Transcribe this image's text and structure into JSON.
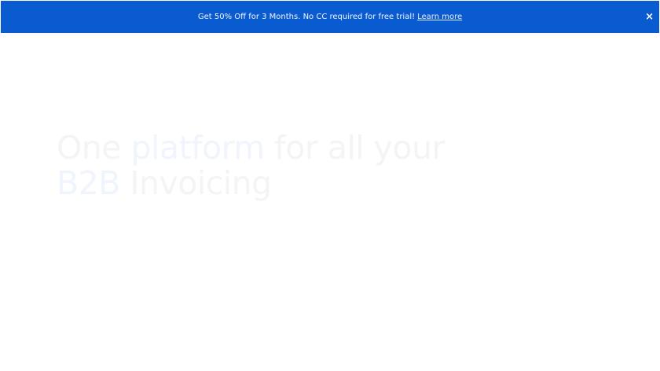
{
  "banner": {
    "text": "Get 50% Off for 3 Months. No CC required for free trial!",
    "link": "Learn more",
    "close": "×",
    "color": "#0b5bd0"
  },
  "hero": {
    "w1": "One",
    "w2": "platform",
    "w3": "for all your",
    "w4": "B2B",
    "w5": "Invoicing"
  }
}
